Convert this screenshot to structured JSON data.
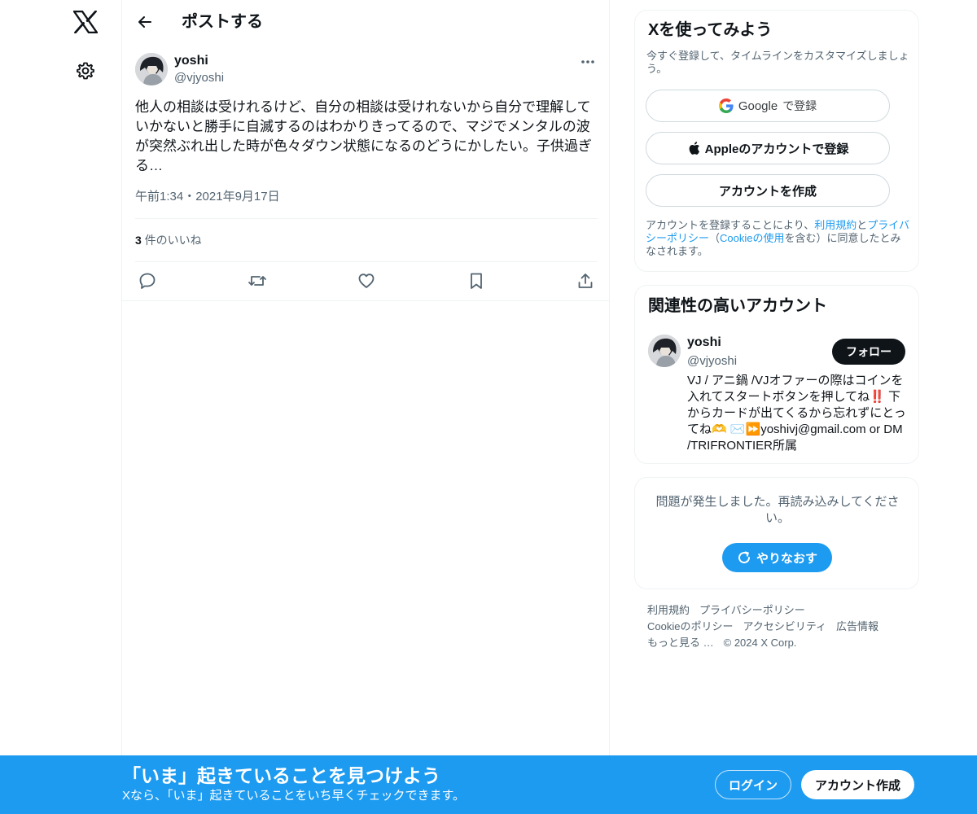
{
  "nav": {
    "logo_icon": "x-logo-icon",
    "settings_icon": "gear-icon"
  },
  "header": {
    "title": "ポストする",
    "back_icon": "arrow-left-icon"
  },
  "post": {
    "author_name": "yoshi",
    "author_handle": "@vjyoshi",
    "text": "他人の相談は受けれるけど、自分の相談は受けれないから自分で理解していかないと勝手に自滅するのはわかりきってるので、マジでメンタルの波が突然ぶれ出した時が色々ダウン状態になるのどうにかしたい。子供過ぎる…",
    "time": "午前1:34・2021年9月17日",
    "likes_count": "3",
    "likes_label": " 件のいいね"
  },
  "signup": {
    "title": "Xを使ってみよう",
    "subtitle": "今すぐ登録して、タイムラインをカスタマイズしましょう。",
    "google_brand": "Google",
    "google_suffix": "で登録",
    "apple_label": "Appleのアカウントで登録",
    "create_label": "アカウントを作成",
    "legal_prefix": "アカウントを登録することにより、",
    "legal_terms": "利用規約",
    "legal_and": "と",
    "legal_privacy": "プライバシーポリシー",
    "legal_open": "（",
    "legal_cookie": "Cookieの使用",
    "legal_suffix": "を含む）に同意したとみなされます。"
  },
  "related": {
    "title": "関連性の高いアカウント",
    "name": "yoshi",
    "handle": "@vjyoshi",
    "follow_label": "フォロー",
    "bio": "VJ / アニ鍋 /VJオファーの際はコインを入れてスタートボタンを押してね‼️ 下からカードが出てくるから忘れずにとってね🫶 ✉️⏩yoshivj@gmail.com or DM /TRIFRONTIER所属"
  },
  "error": {
    "message": "問題が発生しました。再読み込みしてください。",
    "retry_label": "やりなおす"
  },
  "footer": {
    "links": [
      "利用規約",
      "プライバシーポリシー",
      "Cookieのポリシー",
      "アクセシビリティ",
      "広告情報",
      "もっと見る …",
      "© 2024 X Corp."
    ]
  },
  "bottom_bar": {
    "title": "「いま」起きていることを見つけよう",
    "subtitle": "Xなら、「いま」起きていることをいち早くチェックできます。",
    "login_label": "ログイン",
    "signup_label": "アカウント作成"
  },
  "colors": {
    "accent": "#1d9bf0",
    "text": "#0f1419",
    "secondary": "#536471",
    "border": "#eff3f4"
  }
}
